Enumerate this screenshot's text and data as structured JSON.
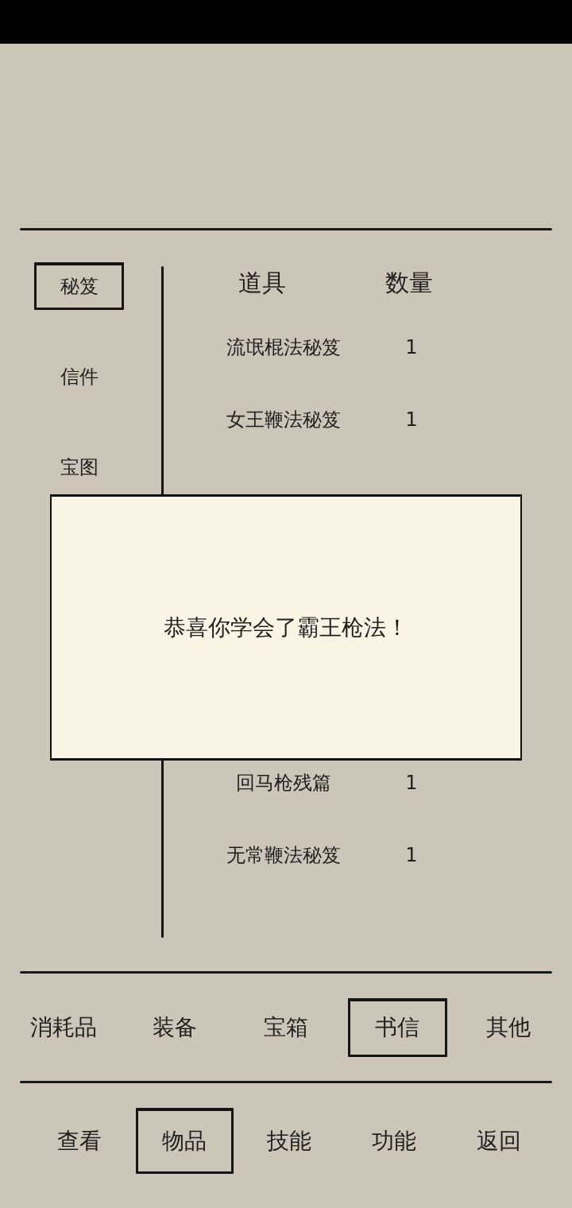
{
  "sidebar": {
    "items": [
      {
        "label": "秘笈",
        "selected": true
      },
      {
        "label": "信件",
        "selected": false
      },
      {
        "label": "宝图",
        "selected": false
      }
    ]
  },
  "item_list": {
    "columns": [
      "道具",
      "数量"
    ],
    "rows_above_dialog": [
      {
        "name": "流氓棍法秘笈",
        "count": "1"
      },
      {
        "name": "女王鞭法秘笈",
        "count": "1"
      }
    ],
    "rows_below_dialog": [
      {
        "name": "回马枪残篇",
        "count": "1"
      },
      {
        "name": "无常鞭法秘笈",
        "count": "1"
      }
    ]
  },
  "category_tabs": [
    {
      "label": "消耗品",
      "selected": false
    },
    {
      "label": "装备",
      "selected": false
    },
    {
      "label": "宝箱",
      "selected": false
    },
    {
      "label": "书信",
      "selected": true
    },
    {
      "label": "其他",
      "selected": false
    }
  ],
  "bottom_nav": [
    {
      "label": "查看",
      "selected": false
    },
    {
      "label": "物品",
      "selected": true
    },
    {
      "label": "技能",
      "selected": false
    },
    {
      "label": "功能",
      "selected": false
    },
    {
      "label": "返回",
      "selected": false
    }
  ],
  "dialog": {
    "message": "恭喜你学会了霸王枪法！"
  }
}
